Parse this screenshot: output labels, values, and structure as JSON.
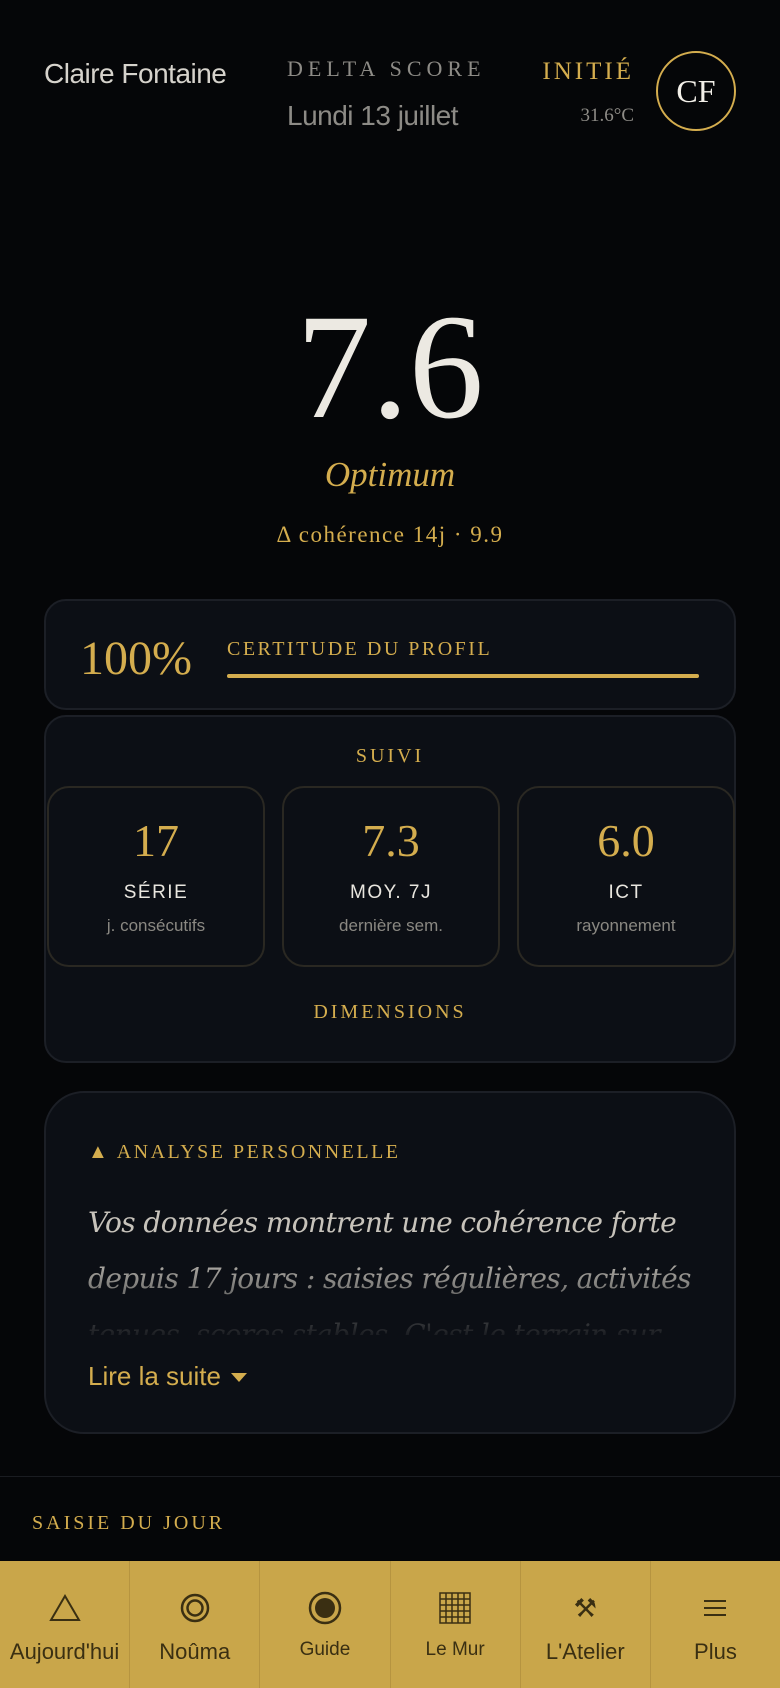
{
  "header": {
    "user_name": "Claire Fontaine",
    "app_title": "DELTA SCORE",
    "date": "Lundi 13 juillet",
    "rank": "INITIÉ",
    "temperature": "31.6°C",
    "avatar_initials": "CF"
  },
  "hero": {
    "score": "7.6",
    "label": "Optimum",
    "coherence": "Δ cohérence 14j · 9.9"
  },
  "certitude": {
    "value": "100%",
    "title": "CERTITUDE DU PROFIL",
    "progress": 1.0
  },
  "suivi": {
    "title": "SUIVI",
    "stats": [
      {
        "value": "17",
        "label": "SÉRIE",
        "sub": "j. consécutifs"
      },
      {
        "value": "7.3",
        "label": "MOY. 7J",
        "sub": "dernière sem."
      },
      {
        "value": "6.0",
        "label": "ICT",
        "sub": "rayonnement"
      }
    ],
    "dimensions_title": "DIMENSIONS"
  },
  "analyse": {
    "title": "▲ ANALYSE PERSONNELLE",
    "body": "Vos données montrent une cohérence forte depuis 17 jours : saisies régulières, activités tenues, scores stables. C'est le terrain sur",
    "read_more": "Lire la suite"
  },
  "saisie": {
    "title": "SAISIE DU JOUR"
  },
  "nav": {
    "items": [
      {
        "label": "Aujourd'hui",
        "icon": "triangle-icon"
      },
      {
        "label": "Noûma",
        "icon": "ring-icon"
      },
      {
        "label": "Guide",
        "icon": "target-icon"
      },
      {
        "label": "Le Mur",
        "icon": "grid-icon"
      },
      {
        "label": "L'Atelier",
        "icon": "tools-icon"
      },
      {
        "label": "Plus",
        "icon": "menu-icon"
      }
    ]
  },
  "colors": {
    "background": "#050608",
    "accent": "#d4ad4e",
    "card": "#0c0f15",
    "nav": "#c9a64a"
  }
}
